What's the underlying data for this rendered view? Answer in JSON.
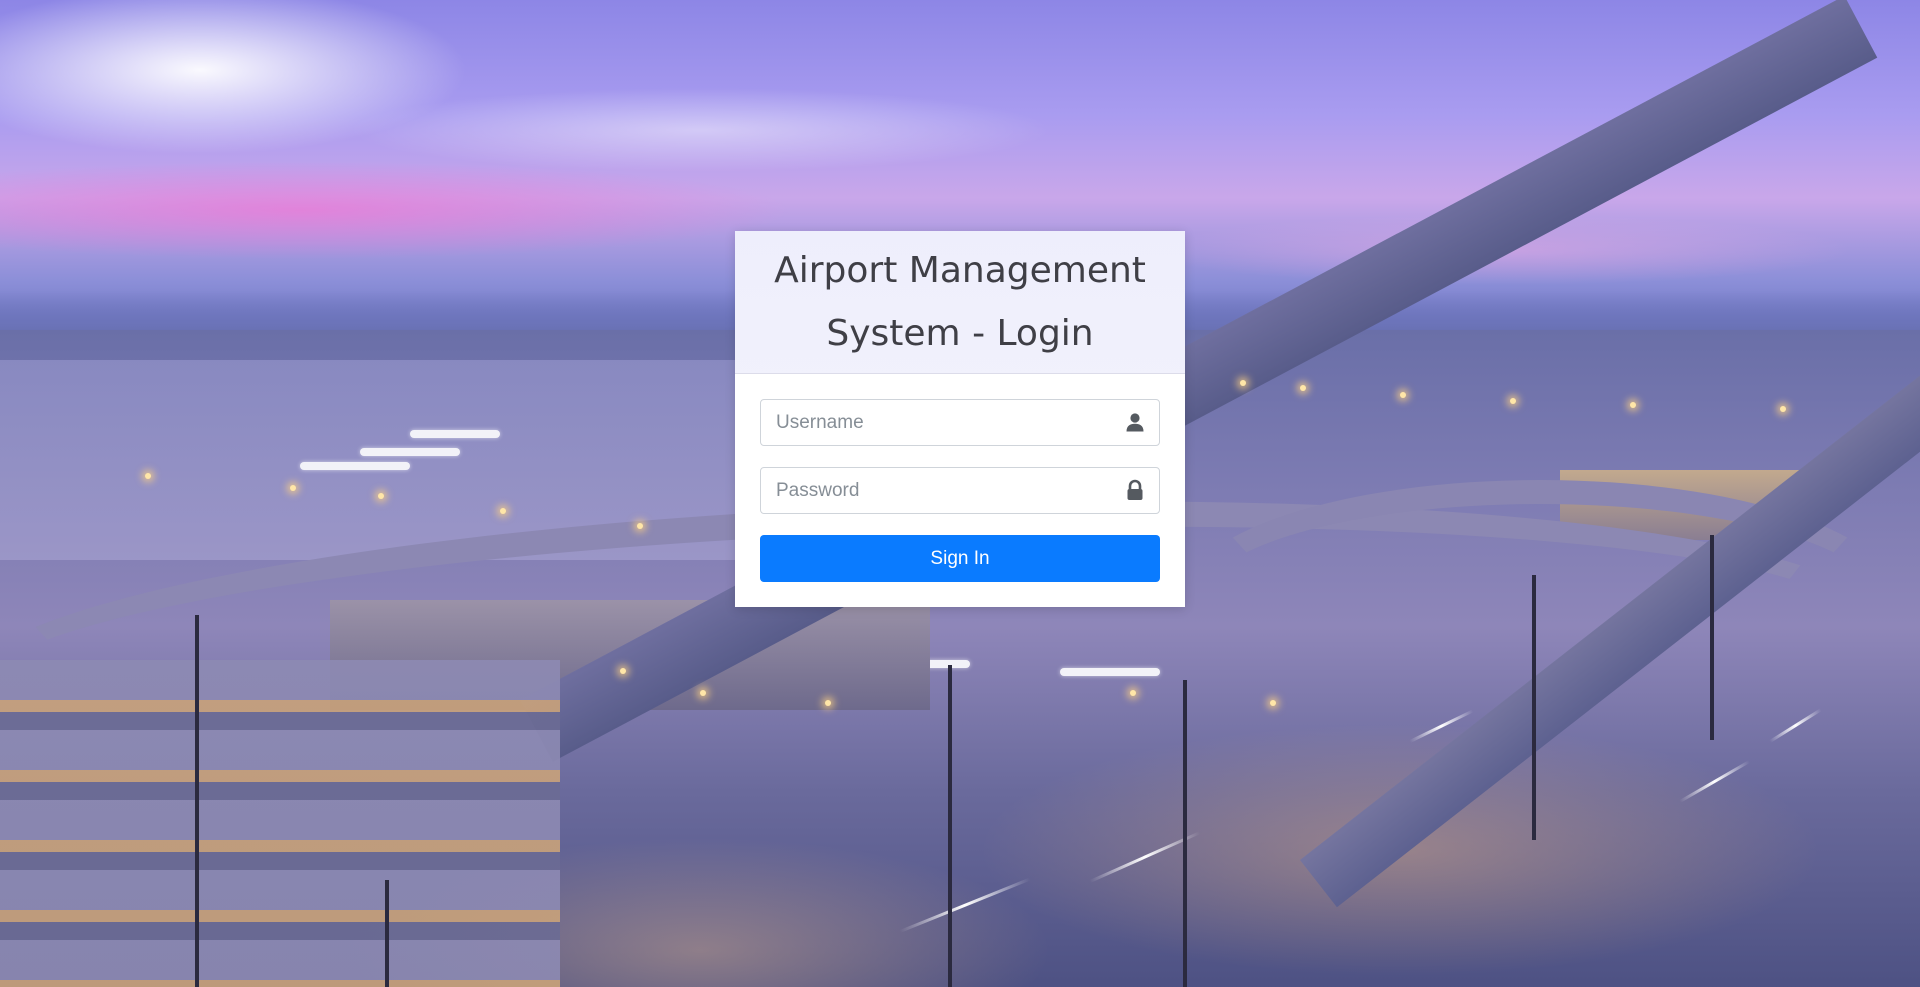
{
  "login": {
    "title": "Airport Management System - Login",
    "username": {
      "placeholder": "Username",
      "value": "",
      "icon": "user-icon"
    },
    "password": {
      "placeholder": "Password",
      "value": "",
      "icon": "lock-icon"
    },
    "signin_label": "Sign In"
  },
  "colors": {
    "primary": "#0a7bff",
    "header_bg": "#eeeefb",
    "title_text": "#3f3f46"
  }
}
